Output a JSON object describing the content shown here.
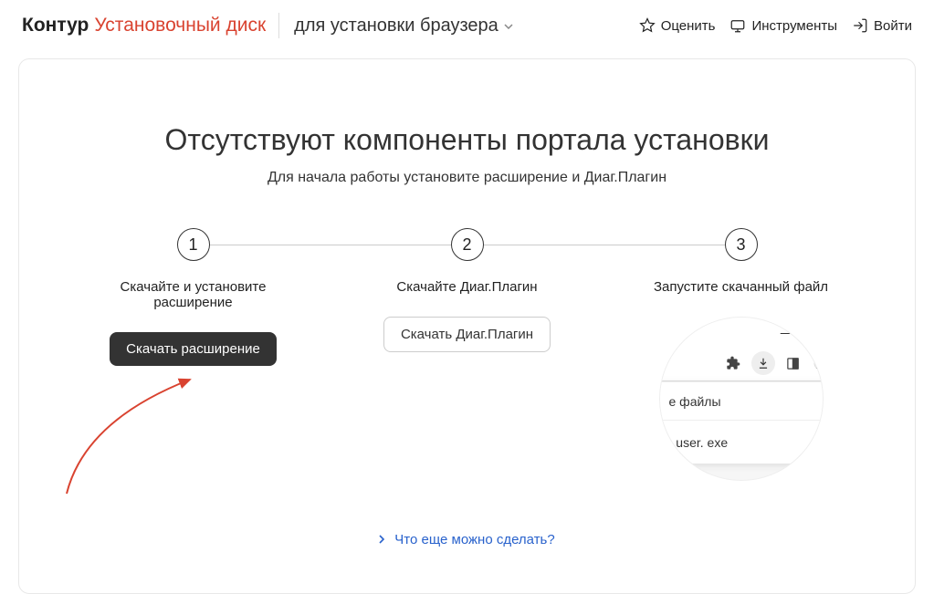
{
  "header": {
    "brand": "Контур",
    "brand_sub": "Установочный диск",
    "subtitle": "для установки браузера",
    "rate": "Оценить",
    "tools": "Инструменты",
    "login": "Войти"
  },
  "main": {
    "title": "Отсутствуют компоненты портала установки",
    "subtitle": "Для начала работы установите расширение и Диаг.Плагин",
    "steps": [
      {
        "num": "1",
        "label": "Скачайте и установите расширение",
        "button": "Скачать расширение"
      },
      {
        "num": "2",
        "label": "Скачайте Диаг.Плагин",
        "button": "Скачать Диаг.Плагин"
      },
      {
        "num": "3",
        "label": "Запустите скачанный файл"
      }
    ],
    "mock": {
      "popup_header": "е файлы",
      "file_name": "_user. exe"
    },
    "help_link": "Что еще можно сделать?"
  }
}
